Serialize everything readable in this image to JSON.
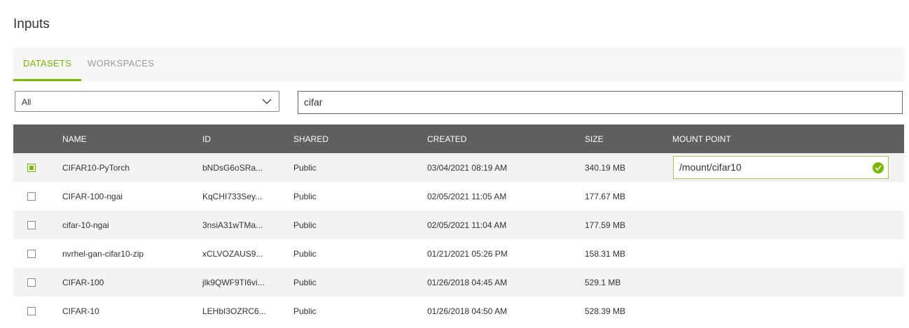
{
  "title": "Inputs",
  "tabs": [
    {
      "label": "DATASETS",
      "active": true
    },
    {
      "label": "WORKSPACES",
      "active": false
    }
  ],
  "filter": {
    "selected": "All"
  },
  "search": {
    "value": "cifar"
  },
  "table": {
    "columns": [
      "NAME",
      "ID",
      "SHARED",
      "CREATED",
      "SIZE",
      "MOUNT POINT"
    ],
    "rows": [
      {
        "checked": true,
        "name": "CIFAR10-PyTorch",
        "id": "bNDsG6oSRa...",
        "shared": "Public",
        "created": "03/04/2021 08:19 AM",
        "size": "340.19 MB",
        "mount": "/mount/cifar10"
      },
      {
        "checked": false,
        "name": "CIFAR-100-ngai",
        "id": "KqCHI733Sey...",
        "shared": "Public",
        "created": "02/05/2021 11:05 AM",
        "size": "177.67 MB",
        "mount": ""
      },
      {
        "checked": false,
        "name": "cifar-10-ngai",
        "id": "3nsiA31wTMa...",
        "shared": "Public",
        "created": "02/05/2021 11:04 AM",
        "size": "177.59 MB",
        "mount": ""
      },
      {
        "checked": false,
        "name": "nvrhel-gan-cifar10-zip",
        "id": "xCLVOZAUS9...",
        "shared": "Public",
        "created": "01/21/2021 05:26 PM",
        "size": "158.31 MB",
        "mount": ""
      },
      {
        "checked": false,
        "name": "CIFAR-100",
        "id": "jlk9QWF9TI6vi...",
        "shared": "Public",
        "created": "01/26/2018 04:45 AM",
        "size": "529.1 MB",
        "mount": ""
      },
      {
        "checked": false,
        "name": "CIFAR-10",
        "id": "LEHbI3OZRC6...",
        "shared": "Public",
        "created": "01/26/2018 04:50 AM",
        "size": "528.39 MB",
        "mount": ""
      }
    ]
  },
  "colors": {
    "accent": "#76b900",
    "header_bg": "#5f5f5f",
    "row_alt": "#f3f3f3"
  },
  "icons": {
    "select": "chevron-down-icon",
    "mount_status": "check-circle-icon"
  }
}
